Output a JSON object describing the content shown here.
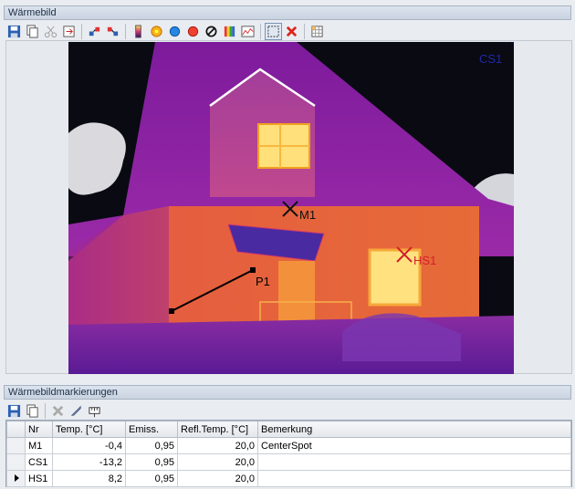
{
  "thermal_panel": {
    "title": "Wärmebild"
  },
  "toolbar_icons": [
    "save-icon",
    "copy-icon",
    "cut-icon",
    "export-icon",
    "move-marker-icon",
    "marker-settings-icon",
    "palette-bar-icon",
    "spot-hot-icon",
    "spot-cold-icon",
    "spot-red-icon",
    "no-entry-icon",
    "palette-icon",
    "histogram-icon",
    "selection-icon",
    "delete-icon",
    "grid-icon"
  ],
  "markers": {
    "m1": "M1",
    "hs1": "HS1",
    "cs1": "CS1",
    "p1": "P1",
    "colors": {
      "m1": "#111111",
      "hs1": "#d2202a",
      "cs1": "#1e2aa8",
      "p1": "#000000"
    }
  },
  "markers_panel": {
    "title": "Wärmebildmarkierungen",
    "toolbar_icons": [
      "save-icon",
      "copy-icon",
      "delete-icon",
      "pen-icon",
      "measure-icon"
    ],
    "columns": [
      "Nr",
      "Temp. [°C]",
      "Emiss.",
      "Refl.Temp. [°C]",
      "Bemerkung"
    ],
    "rows": [
      {
        "nr": "M1",
        "temp": "-0,4",
        "emiss": "0,95",
        "refl": "20,0",
        "note": "CenterSpot"
      },
      {
        "nr": "CS1",
        "temp": "-13,2",
        "emiss": "0,95",
        "refl": "20,0",
        "note": ""
      },
      {
        "nr": "HS1",
        "temp": "8,2",
        "emiss": "0,95",
        "refl": "20,0",
        "note": ""
      }
    ]
  }
}
